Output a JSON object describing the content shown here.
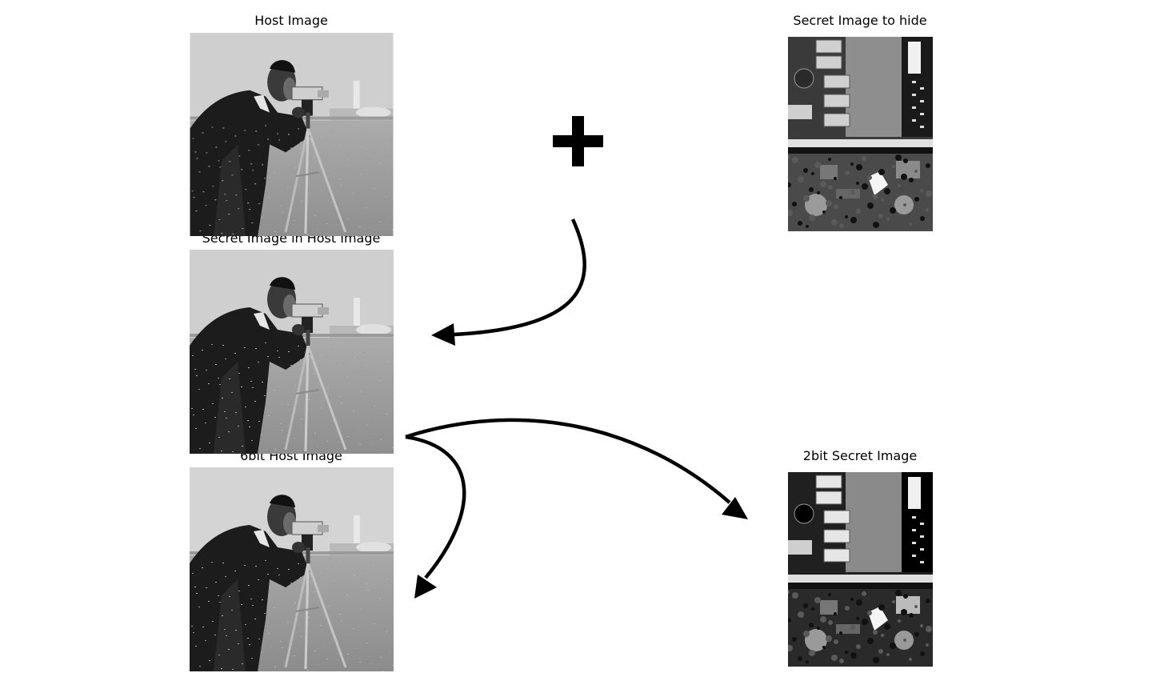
{
  "panels": {
    "host": {
      "title": "Host Image"
    },
    "secret": {
      "title": "Secret Image to hide"
    },
    "stego": {
      "title": "Secret Image in Host Image"
    },
    "host6": {
      "title": "6bit Host Image"
    },
    "secret2": {
      "title": "2bit Secret Image"
    }
  },
  "symbols": {
    "plus": "plus-sign",
    "arrows": [
      "curved-arrow-to-stego",
      "curved-arrow-to-host6",
      "curved-arrow-to-secret2"
    ]
  },
  "colors": {
    "ink": "#000000",
    "background": "#ffffff"
  }
}
